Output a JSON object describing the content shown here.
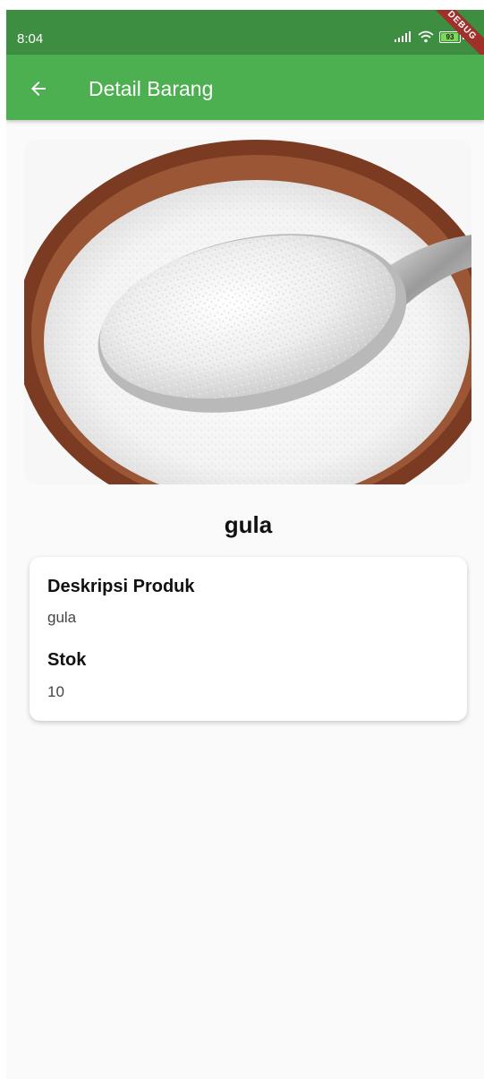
{
  "status_bar": {
    "time": "8:04",
    "battery_level": "93",
    "signal_icon": "signal-bars-icon",
    "wifi_icon": "wifi-icon",
    "debug_label": "DEBUG"
  },
  "app_bar": {
    "title": "Detail Barang",
    "back_icon": "arrow-back-icon",
    "color": "#4caf50"
  },
  "product": {
    "image": "sugar-spoon-photo",
    "name": "gula",
    "description_label": "Deskripsi Produk",
    "description": "gula",
    "stock_label": "Stok",
    "stock": "10"
  }
}
